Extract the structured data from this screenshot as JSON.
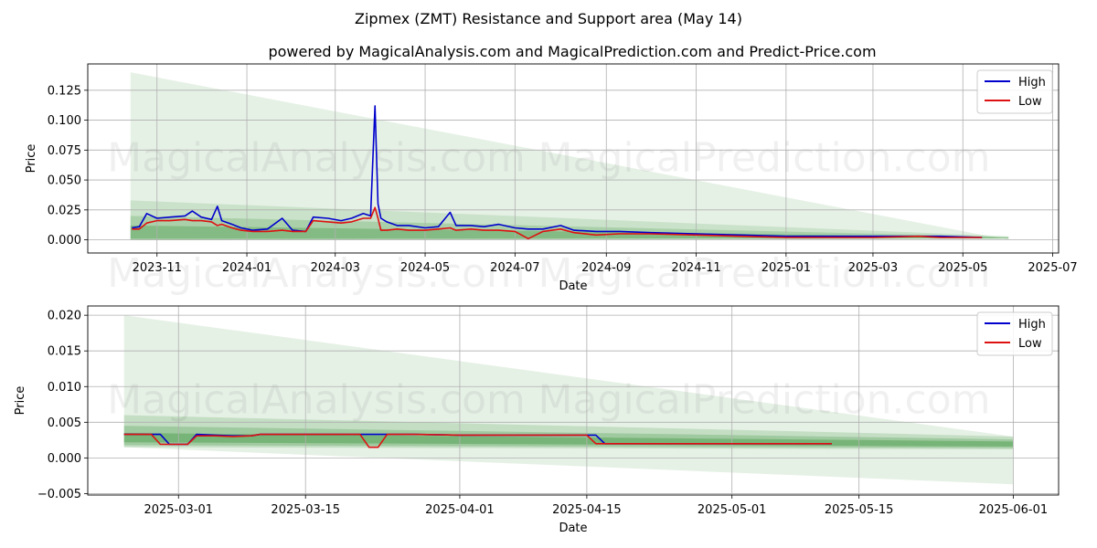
{
  "title": "Zipmex (ZMT) Resistance and Support area (May 14)",
  "subtitle": "powered by MagicalAnalysis.com and MagicalPrediction.com and Predict-Price.com",
  "watermarks": [
    "MagicalAnalysis.com",
    "MagicalPrediction.com"
  ],
  "colors": {
    "high": "#0000cc",
    "low": "#dd1111",
    "band": "#2e8b2e",
    "grid": "#b0b0b0"
  },
  "chart_data": [
    {
      "type": "line",
      "xlabel": "Date",
      "ylabel": "Price",
      "x_ticks": [
        "2023-11",
        "2024-01",
        "2024-03",
        "2024-05",
        "2024-07",
        "2024-09",
        "2024-11",
        "2025-01",
        "2025-03",
        "2025-05",
        "2025-07"
      ],
      "y_ticks": [
        "0.000",
        "0.025",
        "0.050",
        "0.075",
        "0.100",
        "0.125"
      ],
      "xlim": [
        "2023-09-15",
        "2025-07-05"
      ],
      "ylim": [
        -0.011,
        0.147
      ],
      "grid": true,
      "legend": "top-right",
      "series": [
        {
          "name": "High",
          "color": "#0000cc",
          "points": [
            [
              "2023-10-15",
              0.01
            ],
            [
              "2023-10-20",
              0.011
            ],
            [
              "2023-10-25",
              0.022
            ],
            [
              "2023-11-01",
              0.018
            ],
            [
              "2023-11-10",
              0.019
            ],
            [
              "2023-11-20",
              0.02
            ],
            [
              "2023-11-25",
              0.024
            ],
            [
              "2023-12-01",
              0.019
            ],
            [
              "2023-12-08",
              0.017
            ],
            [
              "2023-12-12",
              0.028
            ],
            [
              "2023-12-15",
              0.016
            ],
            [
              "2023-12-22",
              0.013
            ],
            [
              "2023-12-28",
              0.01
            ],
            [
              "2024-01-05",
              0.008
            ],
            [
              "2024-01-15",
              0.009
            ],
            [
              "2024-01-25",
              0.018
            ],
            [
              "2024-02-01",
              0.008
            ],
            [
              "2024-02-10",
              0.007
            ],
            [
              "2024-02-15",
              0.019
            ],
            [
              "2024-02-25",
              0.018
            ],
            [
              "2024-03-05",
              0.016
            ],
            [
              "2024-03-12",
              0.018
            ],
            [
              "2024-03-20",
              0.022
            ],
            [
              "2024-03-25",
              0.02
            ],
            [
              "2024-03-28",
              0.112
            ],
            [
              "2024-03-30",
              0.03
            ],
            [
              "2024-04-01",
              0.018
            ],
            [
              "2024-04-05",
              0.015
            ],
            [
              "2024-04-12",
              0.012
            ],
            [
              "2024-04-20",
              0.012
            ],
            [
              "2024-05-01",
              0.01
            ],
            [
              "2024-05-10",
              0.011
            ],
            [
              "2024-05-18",
              0.023
            ],
            [
              "2024-05-22",
              0.012
            ],
            [
              "2024-06-01",
              0.012
            ],
            [
              "2024-06-10",
              0.011
            ],
            [
              "2024-06-20",
              0.013
            ],
            [
              "2024-07-01",
              0.01
            ],
            [
              "2024-07-10",
              0.009
            ],
            [
              "2024-07-20",
              0.009
            ],
            [
              "2024-08-01",
              0.012
            ],
            [
              "2024-08-10",
              0.008
            ],
            [
              "2024-08-25",
              0.007
            ],
            [
              "2024-09-10",
              0.007
            ],
            [
              "2024-10-01",
              0.006
            ],
            [
              "2024-11-01",
              0.005
            ],
            [
              "2024-12-01",
              0.004
            ],
            [
              "2025-01-01",
              0.003
            ],
            [
              "2025-02-01",
              0.003
            ],
            [
              "2025-03-01",
              0.003
            ],
            [
              "2025-04-01",
              0.003
            ],
            [
              "2025-04-16",
              0.003
            ],
            [
              "2025-05-14",
              0.002
            ]
          ]
        },
        {
          "name": "Low",
          "color": "#dd1111",
          "points": [
            [
              "2023-10-15",
              0.009
            ],
            [
              "2023-10-20",
              0.009
            ],
            [
              "2023-10-25",
              0.014
            ],
            [
              "2023-11-01",
              0.016
            ],
            [
              "2023-11-10",
              0.016
            ],
            [
              "2023-11-20",
              0.017
            ],
            [
              "2023-11-25",
              0.016
            ],
            [
              "2023-12-01",
              0.016
            ],
            [
              "2023-12-08",
              0.015
            ],
            [
              "2023-12-12",
              0.012
            ],
            [
              "2023-12-15",
              0.013
            ],
            [
              "2023-12-22",
              0.01
            ],
            [
              "2023-12-28",
              0.008
            ],
            [
              "2024-01-05",
              0.007
            ],
            [
              "2024-01-15",
              0.007
            ],
            [
              "2024-01-25",
              0.008
            ],
            [
              "2024-02-01",
              0.007
            ],
            [
              "2024-02-10",
              0.007
            ],
            [
              "2024-02-15",
              0.016
            ],
            [
              "2024-02-25",
              0.015
            ],
            [
              "2024-03-05",
              0.014
            ],
            [
              "2024-03-12",
              0.015
            ],
            [
              "2024-03-20",
              0.018
            ],
            [
              "2024-03-25",
              0.018
            ],
            [
              "2024-03-28",
              0.027
            ],
            [
              "2024-03-30",
              0.018
            ],
            [
              "2024-04-01",
              0.008
            ],
            [
              "2024-04-05",
              0.008
            ],
            [
              "2024-04-12",
              0.009
            ],
            [
              "2024-04-20",
              0.008
            ],
            [
              "2024-05-01",
              0.008
            ],
            [
              "2024-05-10",
              0.009
            ],
            [
              "2024-05-18",
              0.01
            ],
            [
              "2024-05-22",
              0.008
            ],
            [
              "2024-06-01",
              0.009
            ],
            [
              "2024-06-10",
              0.008
            ],
            [
              "2024-06-20",
              0.008
            ],
            [
              "2024-07-01",
              0.007
            ],
            [
              "2024-07-10",
              0.001
            ],
            [
              "2024-07-20",
              0.007
            ],
            [
              "2024-08-01",
              0.009
            ],
            [
              "2024-08-10",
              0.006
            ],
            [
              "2024-08-25",
              0.004
            ],
            [
              "2024-09-10",
              0.005
            ],
            [
              "2024-10-01",
              0.005
            ],
            [
              "2024-11-01",
              0.004
            ],
            [
              "2024-12-01",
              0.003
            ],
            [
              "2025-01-01",
              0.002
            ],
            [
              "2025-02-01",
              0.002
            ],
            [
              "2025-03-01",
              0.002
            ],
            [
              "2025-04-01",
              0.003
            ],
            [
              "2025-04-16",
              0.002
            ],
            [
              "2025-05-14",
              0.002
            ]
          ]
        }
      ],
      "support_bands": [
        {
          "x": [
            "2023-10-14",
            "2025-06-01"
          ],
          "upper": [
            0.14,
            0.0
          ],
          "lower": [
            0.0,
            0.001
          ],
          "opacity": 0.12
        },
        {
          "x": [
            "2023-10-14",
            "2025-06-01"
          ],
          "upper": [
            0.033,
            0.003
          ],
          "lower": [
            0.0,
            0.001
          ],
          "opacity": 0.15
        },
        {
          "x": [
            "2023-10-14",
            "2025-06-01"
          ],
          "upper": [
            0.02,
            0.0025
          ],
          "lower": [
            0.0,
            0.001
          ],
          "opacity": 0.2
        },
        {
          "x": [
            "2023-10-14",
            "2025-06-01"
          ],
          "upper": [
            0.012,
            0.002
          ],
          "lower": [
            0.001,
            0.0012
          ],
          "opacity": 0.3
        }
      ]
    },
    {
      "type": "line",
      "xlabel": "Date",
      "ylabel": "Price",
      "x_ticks": [
        "2025-03-01",
        "2025-03-15",
        "2025-04-01",
        "2025-04-15",
        "2025-05-01",
        "2025-05-15",
        "2025-06-01"
      ],
      "y_ticks": [
        "−0.005",
        "0.000",
        "0.005",
        "0.010",
        "0.015",
        "0.020"
      ],
      "xlim": [
        "2025-02-19",
        "2025-06-06"
      ],
      "ylim": [
        -0.0052,
        0.0213
      ],
      "grid": true,
      "legend": "top-right",
      "series": [
        {
          "name": "High",
          "color": "#0000cc",
          "points": [
            [
              "2025-02-23",
              0.0033
            ],
            [
              "2025-02-26",
              0.0033
            ],
            [
              "2025-02-27",
              0.0033
            ],
            [
              "2025-02-28",
              0.0019
            ],
            [
              "2025-03-01",
              0.0019
            ],
            [
              "2025-03-02",
              0.0019
            ],
            [
              "2025-03-03",
              0.0033
            ],
            [
              "2025-03-05",
              0.0032
            ],
            [
              "2025-03-07",
              0.0031
            ],
            [
              "2025-03-09",
              0.0031
            ],
            [
              "2025-03-10",
              0.0033
            ],
            [
              "2025-03-13",
              0.0033
            ],
            [
              "2025-03-20",
              0.0033
            ],
            [
              "2025-03-24",
              0.0033
            ],
            [
              "2025-03-27",
              0.0033
            ],
            [
              "2025-04-01",
              0.0032
            ],
            [
              "2025-04-10",
              0.0032
            ],
            [
              "2025-04-15",
              0.0032
            ],
            [
              "2025-04-16",
              0.0032
            ],
            [
              "2025-04-17",
              0.002
            ],
            [
              "2025-04-25",
              0.002
            ],
            [
              "2025-05-01",
              0.002
            ],
            [
              "2025-05-05",
              0.002
            ],
            [
              "2025-05-12",
              0.002
            ]
          ]
        },
        {
          "name": "Low",
          "color": "#dd1111",
          "points": [
            [
              "2025-02-23",
              0.0033
            ],
            [
              "2025-02-26",
              0.0033
            ],
            [
              "2025-02-27",
              0.0019
            ],
            [
              "2025-02-28",
              0.0019
            ],
            [
              "2025-03-01",
              0.0019
            ],
            [
              "2025-03-02",
              0.0019
            ],
            [
              "2025-03-03",
              0.0031
            ],
            [
              "2025-03-05",
              0.0031
            ],
            [
              "2025-03-07",
              0.003
            ],
            [
              "2025-03-09",
              0.0031
            ],
            [
              "2025-03-10",
              0.0033
            ],
            [
              "2025-03-13",
              0.0033
            ],
            [
              "2025-03-20",
              0.0033
            ],
            [
              "2025-03-21",
              0.0033
            ],
            [
              "2025-03-22",
              0.0015
            ],
            [
              "2025-03-23",
              0.0015
            ],
            [
              "2025-03-24",
              0.0033
            ],
            [
              "2025-03-27",
              0.0033
            ],
            [
              "2025-04-01",
              0.0032
            ],
            [
              "2025-04-10",
              0.0032
            ],
            [
              "2025-04-15",
              0.0032
            ],
            [
              "2025-04-16",
              0.002
            ],
            [
              "2025-04-25",
              0.002
            ],
            [
              "2025-05-01",
              0.002
            ],
            [
              "2025-05-05",
              0.002
            ],
            [
              "2025-05-12",
              0.002
            ]
          ]
        }
      ],
      "support_bands": [
        {
          "x": [
            "2025-02-23",
            "2025-06-01"
          ],
          "upper": [
            0.02,
            0.003
          ],
          "lower": [
            0.0015,
            -0.0037
          ],
          "opacity": 0.12
        },
        {
          "x": [
            "2025-02-23",
            "2025-06-01"
          ],
          "upper": [
            0.006,
            0.003
          ],
          "lower": [
            0.0015,
            0.0012
          ],
          "opacity": 0.18
        },
        {
          "x": [
            "2025-02-23",
            "2025-06-01"
          ],
          "upper": [
            0.0045,
            0.0026
          ],
          "lower": [
            0.0018,
            0.0014
          ],
          "opacity": 0.25
        },
        {
          "x": [
            "2025-02-23",
            "2025-06-01"
          ],
          "upper": [
            0.0035,
            0.0023
          ],
          "lower": [
            0.0022,
            0.0016
          ],
          "opacity": 0.35
        }
      ]
    }
  ]
}
